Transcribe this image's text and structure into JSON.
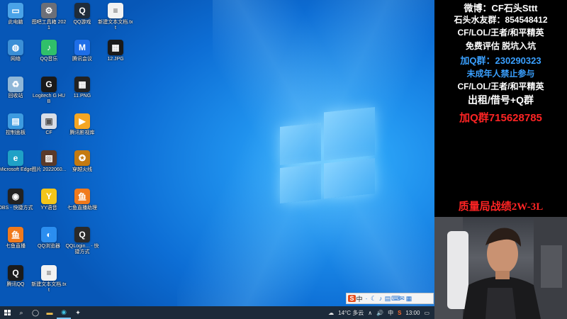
{
  "desktop": {
    "icons": [
      {
        "label": "此电脑",
        "icon": "computer-icon",
        "color": "#4aa3e8",
        "glyph": "▭"
      },
      {
        "label": "网络",
        "icon": "network-icon",
        "color": "#3b8fd6",
        "glyph": "◍"
      },
      {
        "label": "回收站",
        "icon": "recycle-bin-icon",
        "color": "#8fb7d8",
        "glyph": "♻"
      },
      {
        "label": "控制面板",
        "icon": "control-panel-icon",
        "color": "#3d9be0",
        "glyph": "▤"
      },
      {
        "label": "Microsoft Edge",
        "icon": "edge-icon",
        "color": "#1fa1c6",
        "glyph": "e"
      },
      {
        "label": "OBS - 快捷方式",
        "icon": "obs-icon",
        "color": "#222222",
        "glyph": "◉"
      },
      {
        "label": "七鱼直播",
        "icon": "fish-live-icon",
        "color": "#f07a1d",
        "glyph": "鱼"
      },
      {
        "label": "腾讯QQ",
        "icon": "qq-icon",
        "color": "#1b1b1b",
        "glyph": "Q"
      },
      {
        "label": "图吧工具箱 2021",
        "icon": "toolbox-icon",
        "color": "#6c6f78",
        "glyph": "⚙"
      },
      {
        "label": "QQ音乐",
        "icon": "qq-music-icon",
        "color": "#30c06a",
        "glyph": "♪"
      },
      {
        "label": "Logitech G HUB",
        "icon": "logitech-ghub-icon",
        "color": "#1a1a1a",
        "glyph": "G"
      },
      {
        "label": "CF",
        "icon": "cf-icon",
        "color": "#d8dde6",
        "glyph": "▣"
      },
      {
        "label": "图片 2022060...",
        "icon": "photo-icon",
        "color": "#5a3a2a",
        "glyph": "▨"
      },
      {
        "label": "YY语音",
        "icon": "yy-icon",
        "color": "#f3c51a",
        "glyph": "Y"
      },
      {
        "label": "QQ浏览器",
        "icon": "qq-browser-icon",
        "color": "#2b8ef0",
        "glyph": "◐"
      },
      {
        "label": "新建文本文档.txt",
        "icon": "text-file-icon",
        "color": "#f2f2f2",
        "glyph": "≡"
      },
      {
        "label": "QQ游戏",
        "icon": "qq-game-icon",
        "color": "#1f2c3a",
        "glyph": "Q"
      },
      {
        "label": "腾讯会议",
        "icon": "tencent-meeting-icon",
        "color": "#1e6ee8",
        "glyph": "M"
      },
      {
        "label": "11.PNG",
        "icon": "image-file-icon",
        "color": "#222222",
        "glyph": "▦"
      },
      {
        "label": "腾讯影视库",
        "icon": "tencent-video-icon",
        "color": "#f5a623",
        "glyph": "▶"
      },
      {
        "label": "穿越火线",
        "icon": "crossfire-icon",
        "color": "#c47a10",
        "glyph": "✪"
      },
      {
        "label": "七鱼直播助理",
        "icon": "fish-assistant-icon",
        "color": "#f07a1d",
        "glyph": "鱼"
      },
      {
        "label": "QQLogin... - 快捷方式",
        "icon": "qq-login-icon",
        "color": "#2a2a2a",
        "glyph": "Q"
      },
      {
        "label": "新建文本文档.txt",
        "icon": "text-file-icon",
        "color": "#f2f2f2",
        "glyph": "≡"
      },
      {
        "label": "12.JPG",
        "icon": "image-file-icon",
        "color": "#1a1a1a",
        "glyph": "▦"
      }
    ]
  },
  "ime": {
    "items": [
      "S",
      "中",
      "·",
      "☾",
      "♪",
      "▤",
      "⌨",
      "✉",
      "▦"
    ]
  },
  "taskbar": {
    "weather": "14°C 多云",
    "time": "13:00",
    "tray_icons": [
      "∧",
      "🔊",
      "中",
      "S"
    ]
  },
  "panel": {
    "lines": [
      "微博：CF石头Sttt",
      "石头水友群：854548412",
      "CF/LOL/王者/和平精英",
      "免费评估 脱坑入坑",
      "加Q群：230290323",
      "未成年人禁止参与",
      "CF/LOL/王者/和平精英",
      "出租/借号+Q群",
      "加Q群715628785",
      "质量局战绩2W-3L"
    ]
  }
}
